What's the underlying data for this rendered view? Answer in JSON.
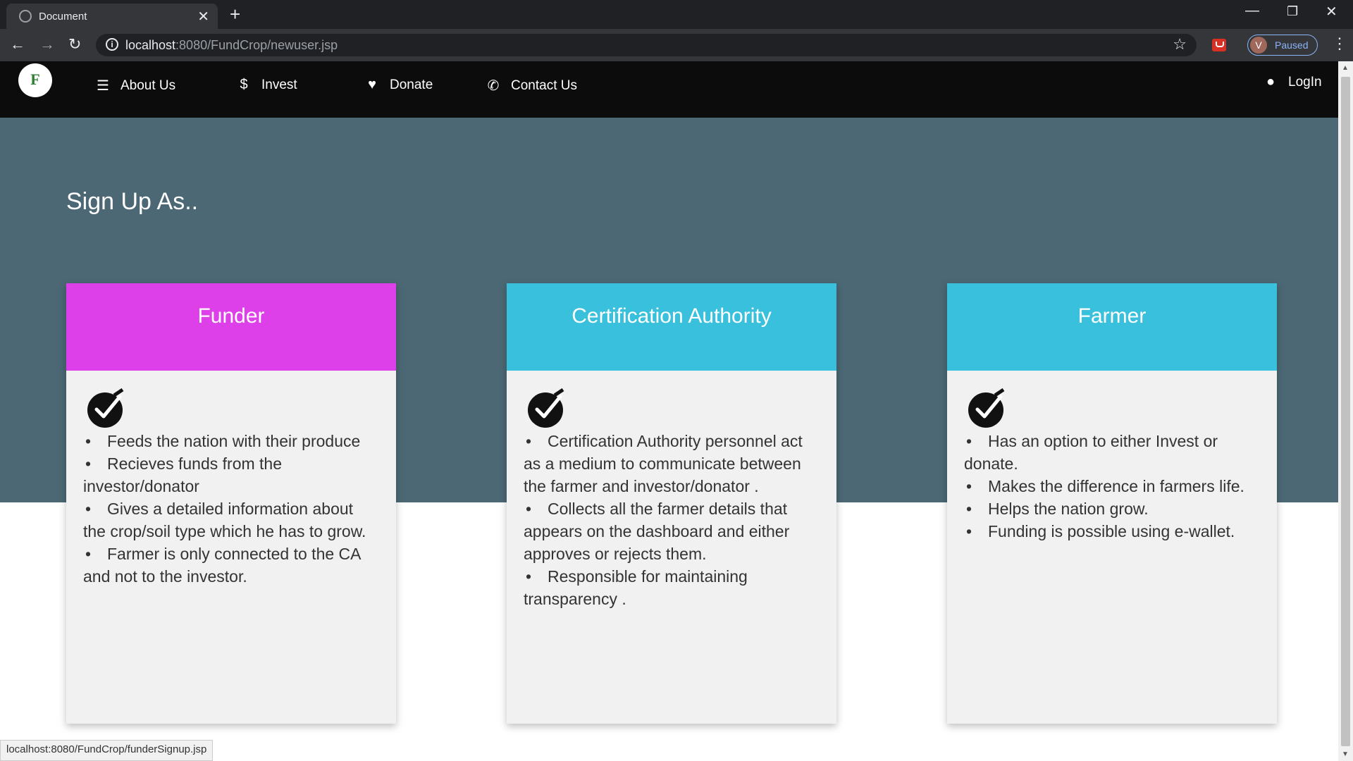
{
  "browser": {
    "tab_title": "Document",
    "tab_close": "✕",
    "new_tab": "+",
    "url_host": "localhost",
    "url_rest": ":8080/FundCrop/newuser.jsp",
    "profile_initial": "V",
    "profile_status": "Paused",
    "status_url": "localhost:8080/FundCrop/funderSignup.jsp"
  },
  "navbar": {
    "logo_letter": "F",
    "items": [
      {
        "label": "About Us",
        "icon": "list-icon"
      },
      {
        "label": "Invest",
        "icon": "dollar-icon"
      },
      {
        "label": "Donate",
        "icon": "heart-icon"
      },
      {
        "label": "Contact Us",
        "icon": "phone-icon"
      }
    ],
    "login": {
      "label": "LogIn",
      "icon": "user-icon"
    }
  },
  "hero": {
    "title": "Sign Up As.."
  },
  "cards": [
    {
      "title": "Funder",
      "color": "#dd3fe8",
      "points": [
        "Feeds the nation with their produce",
        "Recieves funds from the investor/donator",
        "Gives a detailed information about the crop/soil type which he has to grow.",
        "Farmer is only connected to the CA and not to the investor."
      ]
    },
    {
      "title": "Certification Authority",
      "color": "#39c0dc",
      "points": [
        "Certification Authority personnel act as a medium to communicate between the farmer and investor/donator .",
        "Collects all the farmer details that appears on the dashboard and either approves or rejects them.",
        "Responsible for maintaining transparency ."
      ]
    },
    {
      "title": "Farmer",
      "color": "#39c0dc",
      "points": [
        "Has an option to either Invest or donate.",
        "Makes the difference in farmers life.",
        "Helps the nation grow.",
        "Funding is possible using e-wallet."
      ]
    }
  ],
  "colors": {
    "navbar": "#0c0c0c",
    "hero": "#4b6874",
    "card_body": "#f1f1f1"
  }
}
